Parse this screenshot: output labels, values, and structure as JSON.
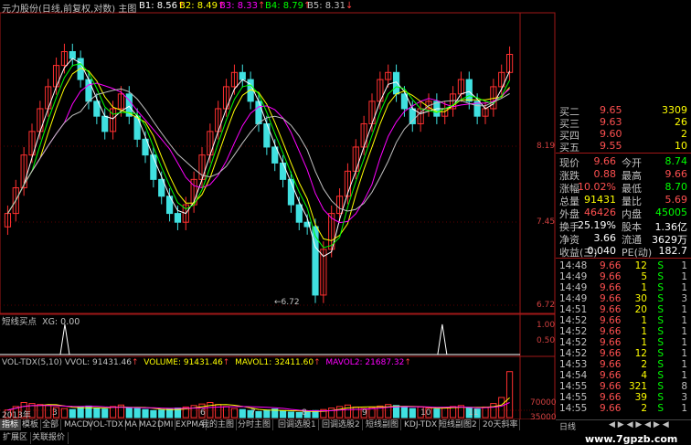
{
  "header": {
    "title": "元力股份(日线,前复权,对数) 主图",
    "b_labels": [
      {
        "name": "B1:",
        "value": "8.56",
        "arrow": "↑",
        "color": "#ffffff"
      },
      {
        "name": "B2:",
        "value": "8.49",
        "arrow": "↑",
        "color": "#ffff00"
      },
      {
        "name": "B3:",
        "value": "8.33",
        "arrow": "↑",
        "color": "#ff00ff"
      },
      {
        "name": "B4:",
        "value": "8.79",
        "arrow": "↑",
        "color": "#00ff00"
      },
      {
        "name": "B5:",
        "value": "8.31",
        "arrow": "↓",
        "color": "#c0c0c0"
      }
    ]
  },
  "main_axis": {
    "labels": [
      "8.19",
      "7.45",
      "6.72"
    ],
    "low_marker": "6.72",
    "date_year": "2013年",
    "month_marks": [
      "3",
      "6",
      "7",
      "8",
      "9",
      "10",
      "11"
    ]
  },
  "signal_panel": {
    "title": "短线买点",
    "xg_label": "XG: 0.00",
    "axis": [
      "1.00",
      "0.50"
    ]
  },
  "volume_panel": {
    "title": "VOL-TDX(5,10)",
    "vvol": "VVOL: 91431.46",
    "volume": "VOLUME: 91431.46",
    "mavol1": "MAVOL1: 32411.60",
    "mavol2": "MAVOL2: 21687.32",
    "axis": [
      "70000",
      "35000"
    ],
    "colors": {
      "volume": "#ffff00",
      "mavol1": "#ffff00",
      "mavol2": "#ff00ff"
    }
  },
  "quote": {
    "asks": [
      {
        "label": "买二",
        "price": "9.65",
        "vol": "3309"
      },
      {
        "label": "买三",
        "price": "9.63",
        "vol": "26"
      },
      {
        "label": "买四",
        "price": "9.60",
        "vol": "2"
      },
      {
        "label": "买五",
        "price": "9.55",
        "vol": "10"
      }
    ],
    "stats": [
      {
        "l1": "现价",
        "v1": "9.66",
        "c1": "#ff5050",
        "l2": "今开",
        "v2": "8.74",
        "c2": "#00ff00"
      },
      {
        "l1": "涨跌",
        "v1": "0.88",
        "c1": "#ff5050",
        "l2": "最高",
        "v2": "9.66",
        "c2": "#ff5050"
      },
      {
        "l1": "涨幅",
        "v1": "10.02%",
        "c1": "#ff5050",
        "l2": "最低",
        "v2": "8.70",
        "c2": "#00ff00"
      },
      {
        "l1": "总量",
        "v1": "91431",
        "c1": "#ffff00",
        "l2": "量比",
        "v2": "5.69",
        "c2": "#ff5050"
      },
      {
        "l1": "外盘",
        "v1": "46426",
        "c1": "#ff5050",
        "l2": "内盘",
        "v2": "45005",
        "c2": "#00ff00"
      },
      {
        "l1": "换手",
        "v1": "25.19%",
        "c1": "#ffffff",
        "l2": "股本",
        "v2": "1.36亿",
        "c2": "#ffffff"
      },
      {
        "l1": "净资",
        "v1": "3.66",
        "c1": "#ffffff",
        "l2": "流通",
        "v2": "3629万",
        "c2": "#ffffff"
      },
      {
        "l1": "收益(三)",
        "v1": "0.040",
        "c1": "#ffffff",
        "l2": "PE(动)",
        "v2": "182.7",
        "c2": "#ffffff"
      }
    ],
    "ticks": [
      {
        "time": "14:48",
        "price": "9.66",
        "vol": "12",
        "side": "S"
      },
      {
        "time": "14:49",
        "price": "9.66",
        "vol": "5",
        "side": "S"
      },
      {
        "time": "14:49",
        "price": "9.66",
        "vol": "1",
        "side": "S"
      },
      {
        "time": "14:49",
        "price": "9.66",
        "vol": "30",
        "side": "S"
      },
      {
        "time": "14:51",
        "price": "9.66",
        "vol": "20",
        "side": "S"
      },
      {
        "time": "14:52",
        "price": "9.66",
        "vol": "1",
        "side": "S"
      },
      {
        "time": "14:52",
        "price": "9.66",
        "vol": "1",
        "side": "S"
      },
      {
        "time": "14:52",
        "price": "9.66",
        "vol": "1",
        "side": "S"
      },
      {
        "time": "14:52",
        "price": "9.66",
        "vol": "12",
        "side": "S"
      },
      {
        "time": "14:53",
        "price": "9.66",
        "vol": "2",
        "side": "S"
      },
      {
        "time": "14:54",
        "price": "9.66",
        "vol": "4",
        "side": "S"
      },
      {
        "time": "14:55",
        "price": "9.66",
        "vol": "321",
        "side": "S"
      },
      {
        "time": "14:55",
        "price": "9.66",
        "vol": "39",
        "side": "S"
      },
      {
        "time": "14:55",
        "price": "9.66",
        "vol": "2",
        "side": "S"
      }
    ],
    "tick_extra": [
      "1",
      "1",
      "1",
      "3",
      "1",
      "1",
      "1",
      "1",
      "1",
      "1",
      "1",
      "8",
      "3",
      "1"
    ]
  },
  "tabs": [
    "指标",
    "模板",
    "全部",
    "MACD",
    "VOL-TDX",
    "MA",
    "MA2",
    "DMI",
    "EXPMA",
    "我的主图",
    "分时主图",
    "回调选股1",
    "回调选股2",
    "短线副图",
    "KDJ-TDX",
    "短线副图2",
    "20天斜率"
  ],
  "bottom_tabs": [
    "扩展区",
    "关联报价"
  ],
  "right_tab": "日线",
  "watermark": "www.7gpzb.com",
  "chart_data": {
    "type": "candlestick",
    "title": "元力股份(日线,前复权,对数) 主图",
    "y_ticks": [
      8.19,
      7.45,
      6.72
    ],
    "ylim": [
      6.6,
      10.2
    ],
    "x_month_labels": [
      "3",
      "6",
      "7",
      "8",
      "9",
      "10",
      "11"
    ],
    "close_series": [
      7.6,
      7.9,
      8.3,
      8.6,
      8.9,
      9.2,
      9.5,
      9.7,
      9.6,
      9.3,
      9.0,
      8.8,
      8.6,
      8.9,
      9.1,
      8.8,
      8.5,
      8.3,
      8.0,
      7.8,
      7.6,
      7.5,
      7.7,
      8.0,
      8.3,
      8.6,
      8.9,
      9.2,
      9.4,
      9.3,
      9.0,
      8.7,
      8.4,
      8.2,
      8.0,
      7.7,
      7.5,
      7.45,
      6.72,
      7.2,
      7.6,
      7.8,
      8.1,
      8.4,
      8.7,
      9.0,
      9.3,
      9.4,
      9.1,
      8.9,
      8.7,
      8.9,
      9.0,
      8.8,
      8.9,
      9.1,
      9.3,
      9.0,
      8.8,
      8.9,
      9.2,
      9.4,
      9.66
    ],
    "signal_spikes": [
      0.12,
      0.86
    ],
    "volume_series": [
      15000,
      22000,
      30000,
      28000,
      26000,
      24000,
      20000,
      18000,
      16000,
      21000,
      23000,
      19000,
      17000,
      22000,
      25000,
      20000,
      18000,
      16000,
      14000,
      15000,
      17000,
      19000,
      21000,
      24000,
      27000,
      30000,
      26000,
      22000,
      18000,
      16000,
      14000,
      12000,
      15000,
      17000,
      13000,
      11000,
      10000,
      12000,
      14000,
      16000,
      19000,
      22000,
      25000,
      21000,
      18000,
      20000,
      23000,
      26000,
      24000,
      20000,
      18000,
      21000,
      19000,
      17000,
      20000,
      22000,
      24000,
      19000,
      17000,
      21000,
      28000,
      40000,
      91431.46
    ],
    "volume_ylim": [
      0,
      100000
    ],
    "volume_ticks": [
      70000,
      35000
    ]
  }
}
